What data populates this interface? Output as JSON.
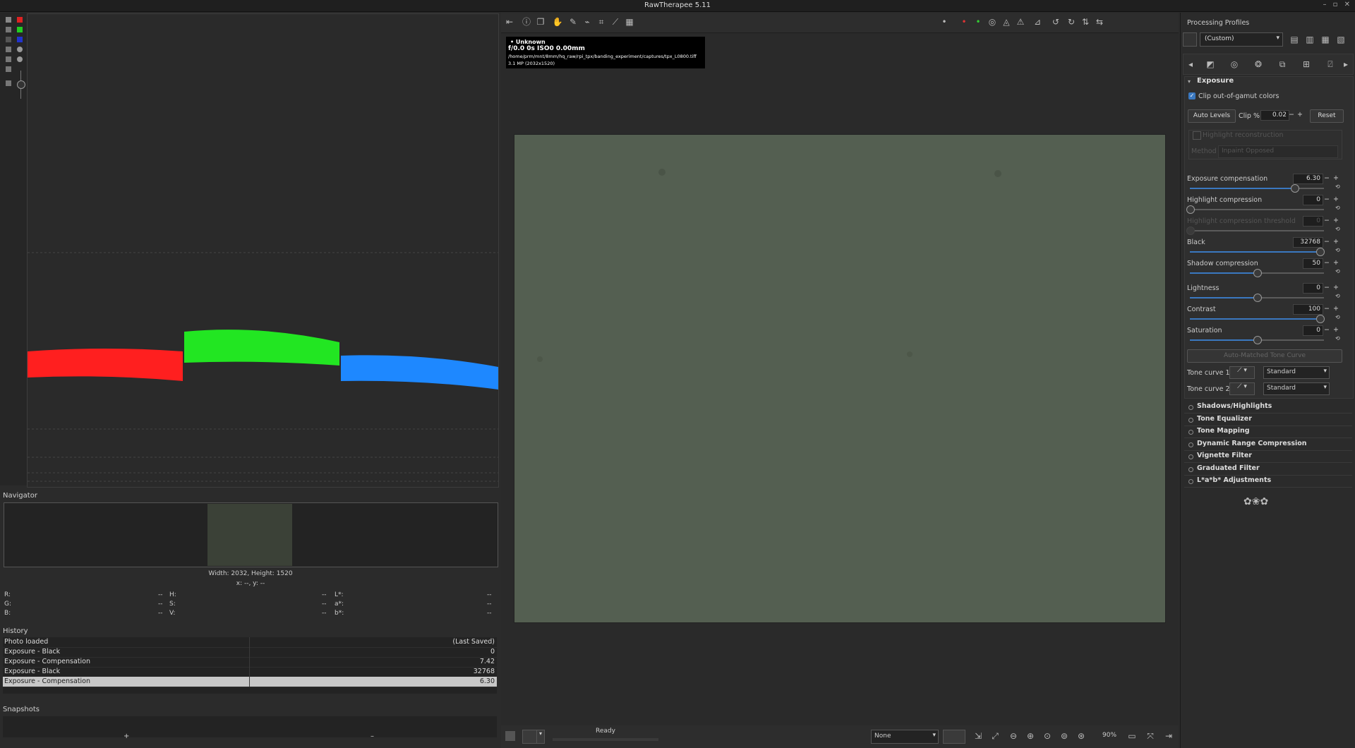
{
  "window": {
    "title": "RawTherapee 5.11",
    "controls": "– ▫ ✕"
  },
  "navigator": {
    "label": "Navigator",
    "size_text": "Width: 2032, Height: 1520",
    "coords_text": "x: --, y: --"
  },
  "pixel_info": {
    "r_label": "R:",
    "g_label": "G:",
    "b_label": "B:",
    "h_label": "H:",
    "s_label": "S:",
    "v_label": "V:",
    "l_label": "L*:",
    "a_label": "a*:",
    "bb_label": "b*:",
    "placeholder": "--"
  },
  "history": {
    "label": "History",
    "rows": [
      {
        "name": "Photo loaded",
        "value": "(Last Saved)"
      },
      {
        "name": "Exposure - Black",
        "value": "0"
      },
      {
        "name": "Exposure - Compensation",
        "value": "7.42"
      },
      {
        "name": "Exposure - Black",
        "value": "32768"
      },
      {
        "name": "Exposure - Compensation",
        "value": "6.30"
      }
    ]
  },
  "snapshots": {
    "label": "Snapshots",
    "add": "+",
    "remove": "–"
  },
  "image_info": {
    "camera": "• Unknown",
    "exif": "f/0.0  0s  ISO0  0.00mm",
    "path": "/home/prm/mnt/8mm/hq_raw/rpi_tpx/banding_experiment/captures/tpx_L0800.tiff",
    "mp": "3.1 MP (2032x1520)"
  },
  "status": {
    "text": "Ready"
  },
  "bottom_toolbar": {
    "profile_select": "None",
    "zoom": "90%"
  },
  "processing_profiles": {
    "label": "Processing Profiles",
    "selected": "(Custom)"
  },
  "exposure": {
    "section_title": "Exposure",
    "clip_gamut_label": "Clip out-of-gamut colors",
    "auto_levels": "Auto Levels",
    "clip_label": "Clip %",
    "clip_value": "0.02",
    "reset": "Reset",
    "highlight_reconstruction": "Highlight reconstruction",
    "method_label": "Method",
    "method_value": "Inpaint Opposed",
    "sliders": [
      {
        "label": "Exposure compensation",
        "value": "6.30",
        "fraction": 0.78,
        "disabled": false
      },
      {
        "label": "Highlight compression",
        "value": "0",
        "fraction": 0.0,
        "disabled": false
      },
      {
        "label": "Highlight compression threshold",
        "value": "0",
        "fraction": 0.0,
        "disabled": true
      },
      {
        "label": "Black",
        "value": "32768",
        "fraction": 0.97,
        "disabled": false
      },
      {
        "label": "Shadow compression",
        "value": "50",
        "fraction": 0.5,
        "disabled": false
      },
      {
        "label": "Lightness",
        "value": "0",
        "fraction": 0.5,
        "disabled": false
      },
      {
        "label": "Contrast",
        "value": "100",
        "fraction": 0.97,
        "disabled": false
      },
      {
        "label": "Saturation",
        "value": "0",
        "fraction": 0.5,
        "disabled": false
      }
    ],
    "auto_matched": "Auto-Matched Tone Curve",
    "tone_curve_1_label": "Tone curve 1:",
    "tone_curve_1_value": "Standard",
    "tone_curve_2_label": "Tone curve 2:",
    "tone_curve_2_value": "Standard"
  },
  "tool_sections": [
    "Shadows/Highlights",
    "Tone Equalizer",
    "Tone Mapping",
    "Dynamic Range Compression",
    "Vignette Filter",
    "Graduated Filter",
    "L*a*b* Adjustments"
  ],
  "colors": {
    "red": "#ff1f1f",
    "green": "#22e622",
    "blue": "#1e88ff",
    "image": "#545f51",
    "accent": "#3a78c0"
  }
}
